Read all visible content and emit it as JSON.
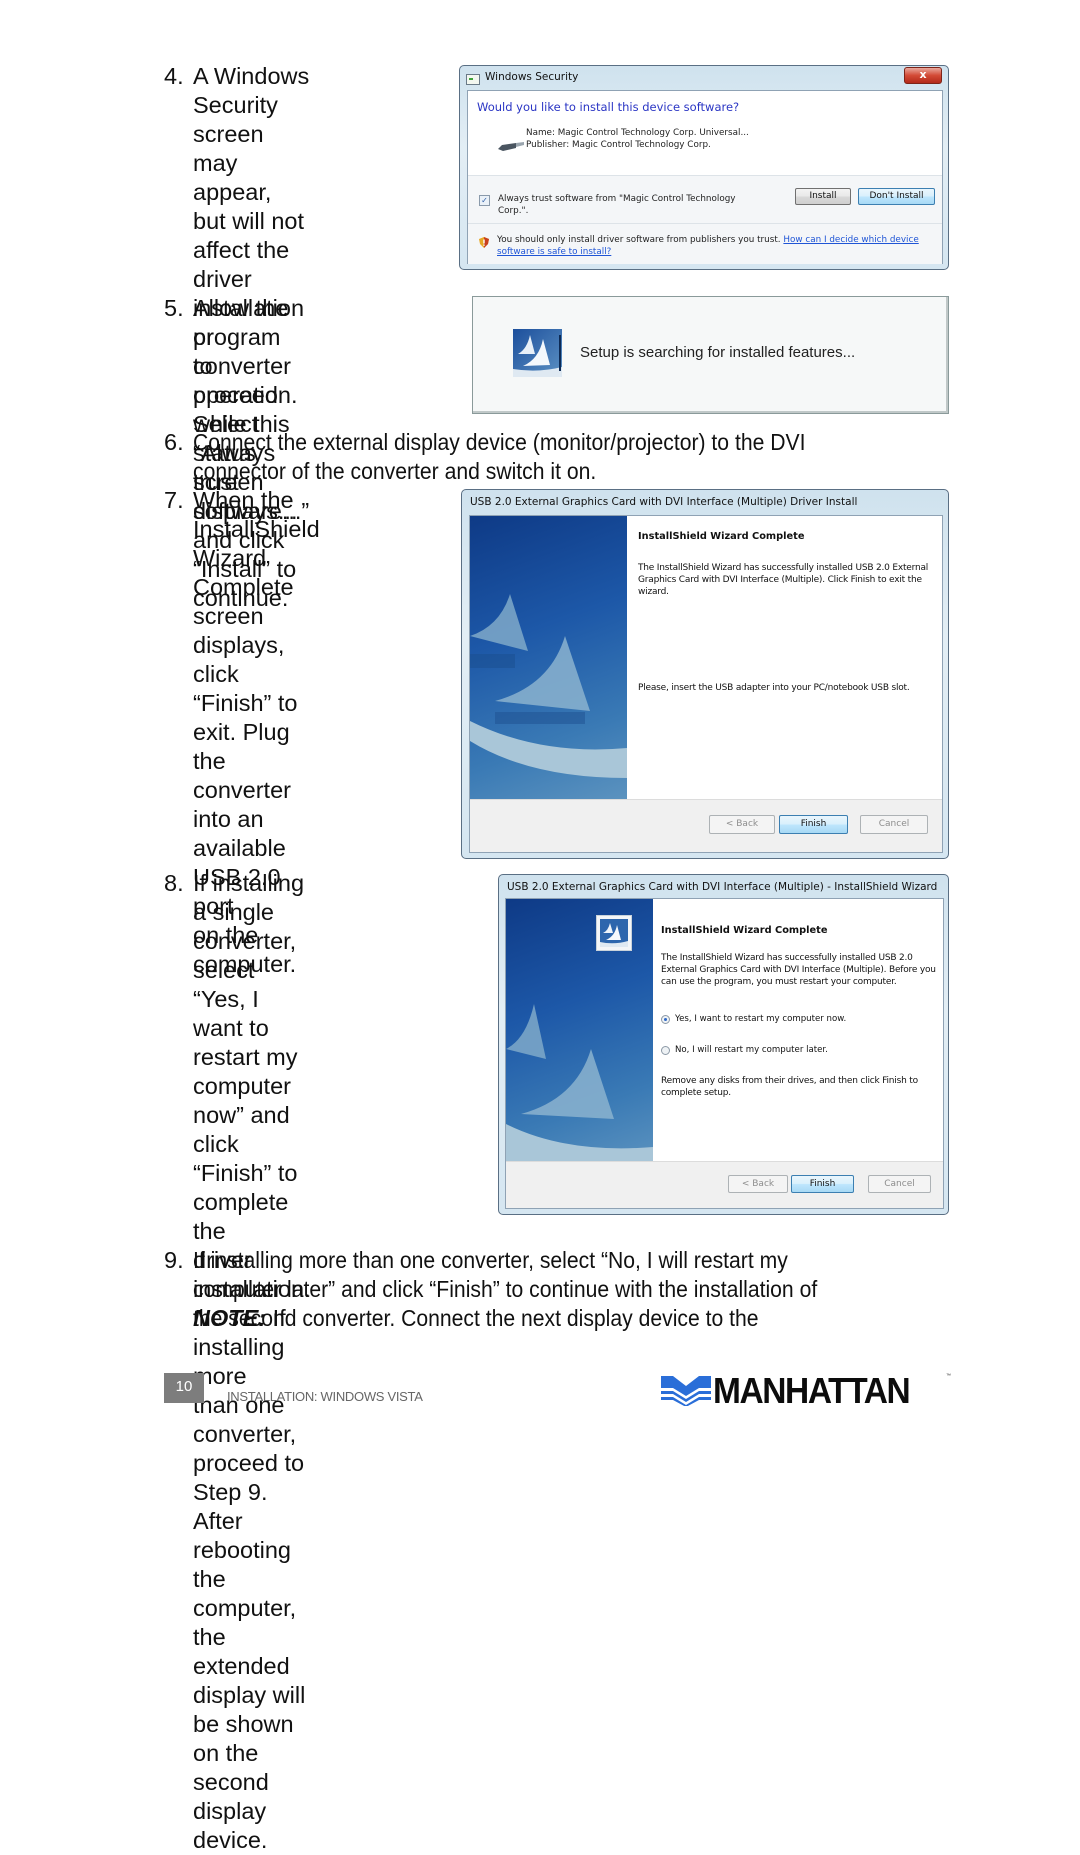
{
  "steps": [
    {
      "num": "4.",
      "text": "A Windows Security\nscreen may appear,\nbut will not affect the\ndriver installation or\nconverter operation.\nSelect “Always trust\nsoftware...” and click\n“Install” to continue."
    },
    {
      "num": "5.",
      "text": "Allow the program to\nproceed while this\nstatus screen displays..."
    },
    {
      "num": "6.",
      "text": "Connect the external display device (monitor/projector) to the DVI\nconnector of the converter and switch it on."
    },
    {
      "num": "7.",
      "text": "When the InstallShield\nWizard Complete\nscreen displays, click\n“Finish” to exit. Plug\nthe converter into an\navailable USB 2.0 port\non the computer."
    },
    {
      "num": "8.",
      "text": "If installing a single\nconverter, select “Yes, I\nwant to restart my\ncomputer now” and click\n“Finish” to complete the\ndriver installation.",
      "note_label": "NOTE:",
      "note_text": " If installing more\nthan one converter,\nproceed to Step 9. After\nrebooting the computer,\nthe extended display will\nbe shown on the second\ndisplay device."
    },
    {
      "num": "9.",
      "text": "If installing more than one converter, select “No, I will restart my\ncomputer later” and click “Finish” to continue with the installation of\nthe second converter. Connect the next display device to the"
    }
  ],
  "windows_security": {
    "title": "Windows Security",
    "close_label": "x",
    "question": "Would you like to install this device software?",
    "name_line": "Name: Magic Control Technology Corp. Universal...",
    "publisher_line": "Publisher: Magic Control Technology Corp.",
    "checkbox_label": "Always trust software from \"Magic Control Technology Corp.\".",
    "checkbox_checked": true,
    "install_label": "Install",
    "dont_install_label": "Don't Install",
    "warning_text": "You should only install driver software from publishers you trust. ",
    "warning_link": "How can I decide which device software is safe to install?"
  },
  "setup_status": {
    "message": "Setup is searching for installed features..."
  },
  "wizard1": {
    "title": "USB 2.0 External Graphics Card with DVI Interface (Multiple) Driver Install",
    "heading": "InstallShield Wizard Complete",
    "para1": "The InstallShield Wizard has successfully installed USB 2.0 External Graphics Card with DVI Interface (Multiple).  Click Finish to exit the wizard.",
    "para2": "Please, insert the USB adapter into your PC/notebook USB slot.",
    "back_label": "< Back",
    "finish_label": "Finish",
    "cancel_label": "Cancel"
  },
  "wizard2": {
    "title": "USB 2.0 External Graphics Card with DVI Interface (Multiple) - InstallShield Wizard",
    "heading": "InstallShield Wizard Complete",
    "para1": "The InstallShield Wizard has successfully installed USB 2.0 External Graphics Card with DVI Interface (Multiple).  Before you can use the program, you must restart your computer.",
    "option_yes": "Yes, I want to restart my computer now.",
    "option_no": "No, I will restart my computer later.",
    "selected_option": "yes",
    "para2": "Remove any disks from their drives, and then click Finish to complete setup.",
    "back_label": "< Back",
    "finish_label": "Finish",
    "cancel_label": "Cancel"
  },
  "footer": {
    "page_number": "10",
    "section": "INSTALLATION: WINDOWS VISTA",
    "brand": "MANHATTAN",
    "trademark": "™",
    "brand_color": "#2a6ed8"
  }
}
